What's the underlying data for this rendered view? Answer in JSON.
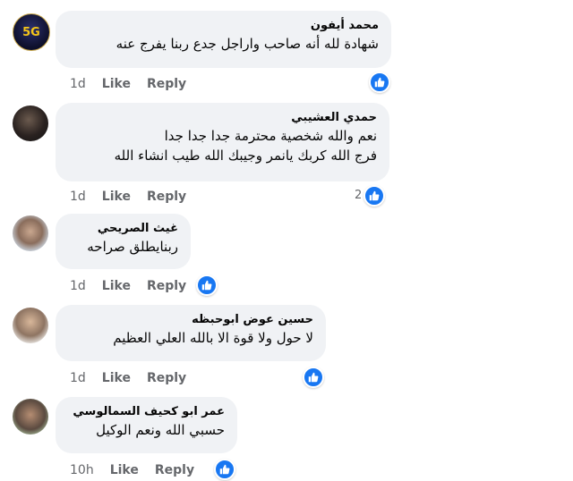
{
  "comments": [
    {
      "author": "محمد أيفون",
      "lines": [
        "شهادة لله أنه صاحب واراجل جدع ربنا يفرج عنه"
      ],
      "time": "1d",
      "like": "Like",
      "reply": "Reply",
      "reaction_count": "",
      "avatar_text": "5G"
    },
    {
      "author": "حمدي العشيبي",
      "lines": [
        "نعم والله شخصية محترمة جدا جدا جدا",
        "فرج الله كربك يانمر وجيبك الله طيب انشاء الله"
      ],
      "time": "1d",
      "like": "Like",
      "reply": "Reply",
      "reaction_count": "2",
      "avatar_text": ""
    },
    {
      "author": "غيث الصريحي",
      "lines": [
        "ربنايطلق صراحه"
      ],
      "time": "1d",
      "like": "Like",
      "reply": "Reply",
      "reaction_count": "",
      "avatar_text": ""
    },
    {
      "author": "حسين عوض ابوحبظه",
      "lines": [
        "لا حول ولا قوة الا بالله العلي العظيم"
      ],
      "time": "1d",
      "like": "Like",
      "reply": "Reply",
      "reaction_count": "",
      "avatar_text": ""
    },
    {
      "author": "عمر ابو كحيف السمالوسي",
      "lines": [
        "حسبي الله ونعم الوكيل"
      ],
      "time": "10h",
      "like": "Like",
      "reply": "Reply",
      "reaction_count": "",
      "avatar_text": ""
    }
  ],
  "colors": {
    "bubble": "#f0f2f5",
    "like_blue": "#1877f2",
    "meta_gray": "#65676b"
  }
}
